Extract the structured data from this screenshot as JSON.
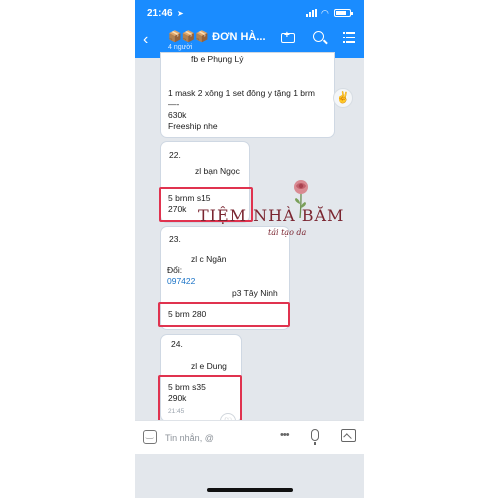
{
  "status_bar": {
    "time": "21:46"
  },
  "header": {
    "title": "📦📦📦 ĐƠN HÀ...",
    "subtitle": "4 người"
  },
  "messages": [
    {
      "lines": [
        "fb e Phụng Lý",
        "1 mask 2 xông 1 set đông y tặng 1 brm",
        "—-",
        "630k",
        "Freeship nhe"
      ]
    },
    {
      "number": "22.",
      "name": "zl bạn Ngọc",
      "highlight": [
        "5 brnm s15",
        "270k"
      ]
    },
    {
      "number": "23.",
      "name": "zl c Ngân",
      "label": "Đổi:",
      "phone": "097422",
      "place": "p3 Tây Ninh",
      "highlight": [
        "5 brm 280"
      ]
    },
    {
      "number": "24.",
      "name": "zl e Dung",
      "highlight": [
        "5 brm s35",
        "290k"
      ],
      "time": "21:45"
    }
  ],
  "input": {
    "placeholder": "Tin nhắn, @"
  },
  "watermark": {
    "main": "TIỆM NHÀ BĂM",
    "sub": "tái tạo da"
  },
  "colors": {
    "accent": "#1a8cff",
    "highlight": "#e0334f",
    "link": "#1a73c7",
    "watermark": "#7a2530"
  }
}
